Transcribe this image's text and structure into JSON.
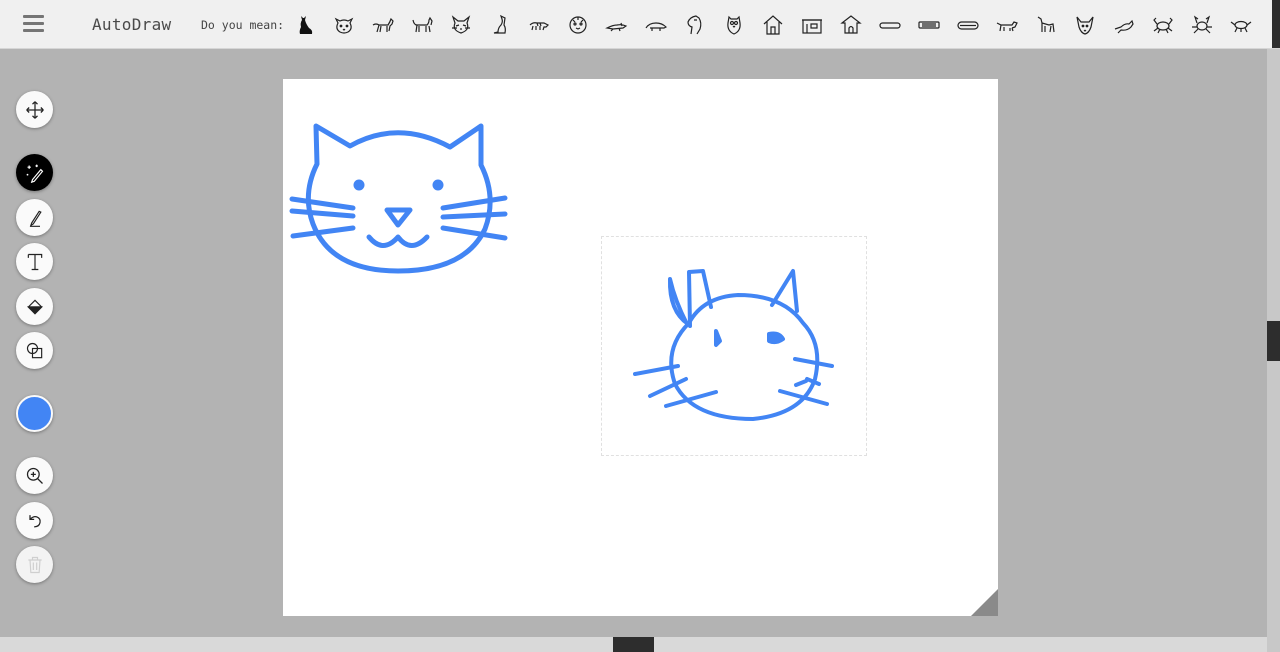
{
  "app": {
    "title": "AutoDraw"
  },
  "toolbar": {
    "menu_icon": "hamburger-menu-icon",
    "suggest_label": "Do you mean:",
    "suggestions": [
      "cat-silhouette",
      "cat-face",
      "cat-walking",
      "cat-standing",
      "cat-face-2",
      "cat-sitting",
      "tiger",
      "tiger-face",
      "lizard",
      "anteater",
      "horse-head",
      "owl",
      "house",
      "building",
      "doghouse",
      "hotdog",
      "tray",
      "hotdog-bun",
      "dog",
      "dog-standing",
      "dog-face",
      "bird",
      "crab",
      "crab-2",
      "bug"
    ]
  },
  "tools": [
    {
      "name": "select-tool",
      "icon": "move-arrows-icon",
      "state": "normal"
    },
    {
      "name": "autodraw-tool",
      "icon": "magic-pen-icon",
      "state": "active"
    },
    {
      "name": "draw-tool",
      "icon": "pencil-icon",
      "state": "normal"
    },
    {
      "name": "type-tool",
      "icon": "text-T-icon",
      "state": "normal"
    },
    {
      "name": "fill-tool",
      "icon": "paint-bucket-icon",
      "state": "normal"
    },
    {
      "name": "shape-tool",
      "icon": "shapes-icon",
      "state": "normal"
    },
    {
      "name": "zoom-tool",
      "icon": "zoom-in-icon",
      "state": "normal"
    },
    {
      "name": "undo-button",
      "icon": "undo-icon",
      "state": "normal"
    },
    {
      "name": "delete-button",
      "icon": "trash-icon",
      "state": "disabled"
    }
  ],
  "colors": {
    "accent": "#4285f4",
    "stroke": "#4285f4",
    "current_color": "#4285f4"
  }
}
